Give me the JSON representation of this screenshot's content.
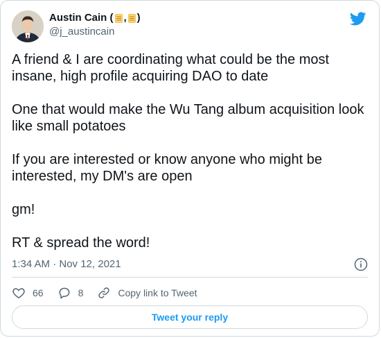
{
  "author": {
    "name": "Austin Cain (",
    "emoji_separator": ",",
    "name_close": ")",
    "handle": "@j_austincain"
  },
  "tweet": {
    "paragraphs": [
      "A friend & I are coordinating what could be the most insane, high profile acquiring DAO to date",
      "One that would make the Wu Tang album acquisition look like small potatoes",
      "If you are interested or know anyone who might be interested, my DM's are open",
      "gm!",
      "RT & spread the word!"
    ],
    "timestamp": "1:34 AM · Nov 12, 2021"
  },
  "actions": {
    "likes": "66",
    "replies": "8",
    "copy_link_label": "Copy link to Tweet"
  },
  "reply_button": {
    "label": "Tweet your reply"
  },
  "icons": {
    "avatar": "avatar",
    "emoji": "scroll-icon",
    "logo": "twitter-bird-icon",
    "info": "info-icon",
    "like": "heart-icon",
    "reply": "comment-icon",
    "link": "link-icon"
  },
  "colors": {
    "accent": "#1d9bf0",
    "text": "#0f1419",
    "muted": "#536471",
    "border": "#cfd9de"
  }
}
